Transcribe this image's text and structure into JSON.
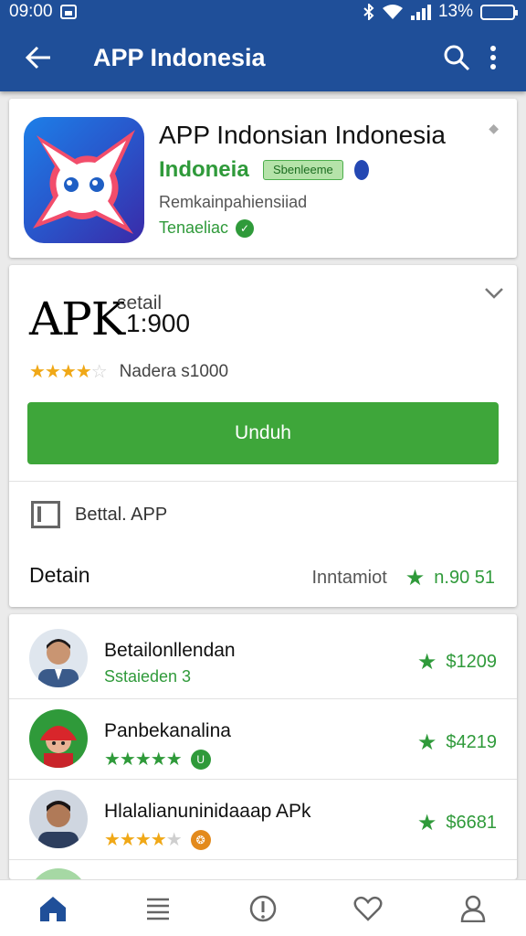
{
  "status": {
    "time": "09:00",
    "battery": "13%"
  },
  "toolbar": {
    "title": "APP Indonesia",
    "back_icon": "arrow-back-icon",
    "search_icon": "search-icon",
    "menu_icon": "more-vert-icon"
  },
  "app": {
    "name": "APP Indonsian Indonesia",
    "developer": "Indoneia",
    "tag": "Sbenleeme",
    "subtitle": "Remkainpahiensiiad",
    "status": "Tenaeliac"
  },
  "apk": {
    "label": "APK",
    "sub_label": "setail",
    "value": "1:900",
    "rating": 4,
    "rating_text": "Nadera s1000",
    "download_label": "Unduh",
    "detail_label": "Bettal. APP",
    "detain_label": "Detain",
    "detain_right_label": "Inntamiot",
    "detain_right_value": "n.90 51"
  },
  "list": [
    {
      "name": "Betailonllendan",
      "sub": "Sstaieden 3",
      "score": "$1209",
      "avatar": "man-suit-avatar"
    },
    {
      "name": "Panbekanalina",
      "rating": 5,
      "score": "$4219",
      "avatar": "red-hat-avatar"
    },
    {
      "name": "Hlalalianuninidaaap APk",
      "rating": 4,
      "score": "$6681",
      "avatar": "man-avatar"
    }
  ],
  "colors": {
    "primary": "#1f4f99",
    "accent": "#3ea63a",
    "star": "#f0a817"
  }
}
